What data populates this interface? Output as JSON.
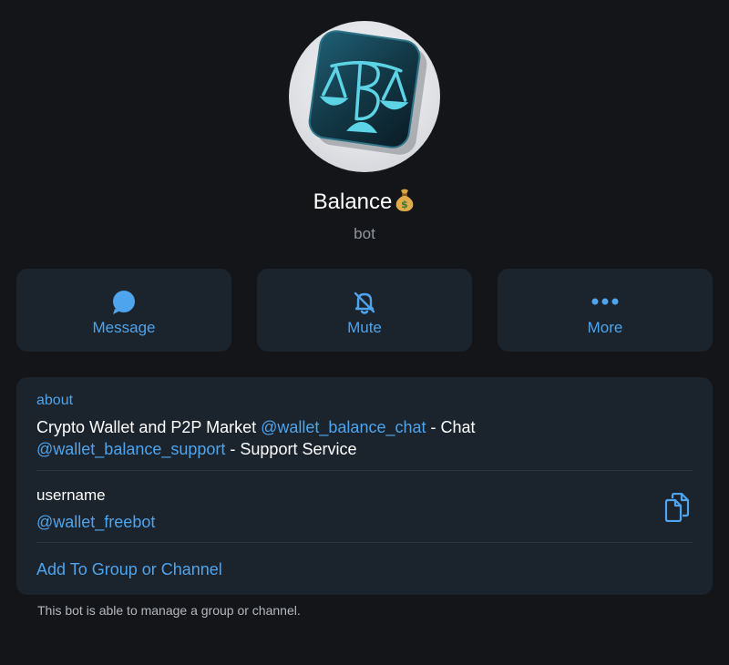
{
  "profile": {
    "name": "Balance",
    "name_emoji": "💰",
    "subtitle": "bot",
    "avatar_icon": "scales-b-logo-icon"
  },
  "actions": [
    {
      "label": "Message",
      "icon": "chat-bubble-icon"
    },
    {
      "label": "Mute",
      "icon": "bell-off-icon"
    },
    {
      "label": "More",
      "icon": "more-dots-icon"
    }
  ],
  "info": {
    "about_label": "about",
    "about_parts": {
      "p1": "Crypto Wallet and P2P Market ",
      "link1": "@wallet_balance_chat",
      "p2": " - Chat",
      "link2": "@wallet_balance_support",
      "p3": " - Support Service"
    },
    "username_label": "username",
    "username_value": "@wallet_freebot",
    "copy_icon": "copy-icon",
    "add_label": "Add To Group or Channel"
  },
  "footnote": "This bot is able to manage a group or channel.",
  "colors": {
    "background": "#131519",
    "card": "#1b232d",
    "accent": "#4ea4ed",
    "muted_text": "#8f969e"
  }
}
